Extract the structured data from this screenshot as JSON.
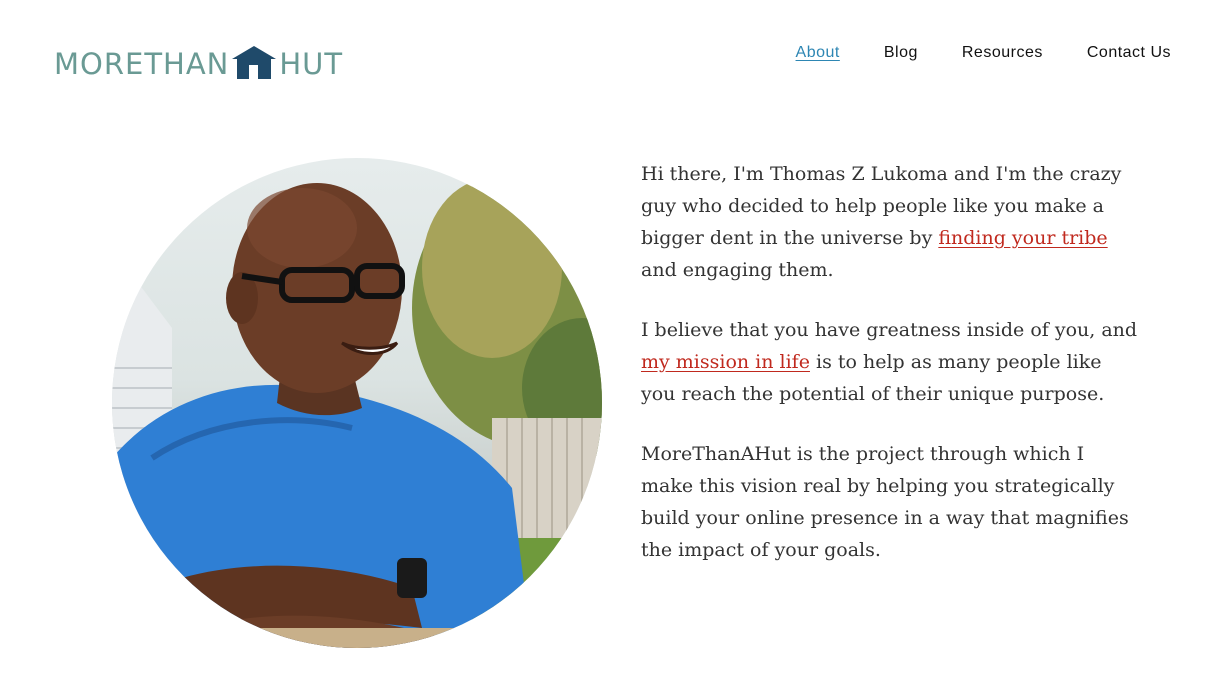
{
  "logo": {
    "part1": "MORETHAN",
    "part2": "HUT",
    "icon": "house-icon",
    "colors": {
      "text": "#6a9a94",
      "house": "#1f4a6a"
    }
  },
  "nav": {
    "items": [
      {
        "label": "About",
        "active": true
      },
      {
        "label": "Blog"
      },
      {
        "label": "Resources"
      },
      {
        "label": "Contact Us"
      }
    ],
    "active_color": "#2d86b3"
  },
  "hero": {
    "photo": "profile-photo"
  },
  "bio": {
    "p1": {
      "before": "Hi there, I'm Thomas Z Lukoma and I'm the crazy guy who decided to help people like you make a bigger dent in the universe by ",
      "link": "finding your tribe",
      "after": " and engaging them."
    },
    "p2": {
      "before": "I believe that you have greatness inside of you, and ",
      "link": "my mission in life",
      "after": " is to help as many people like you reach the potential of their unique purpose."
    },
    "p3": "MoreThanAHut is the project through which I make this vision real by helping you strategically build your online presence in a way that magnifies the impact of your goals.",
    "link_color": "#c0291e"
  }
}
